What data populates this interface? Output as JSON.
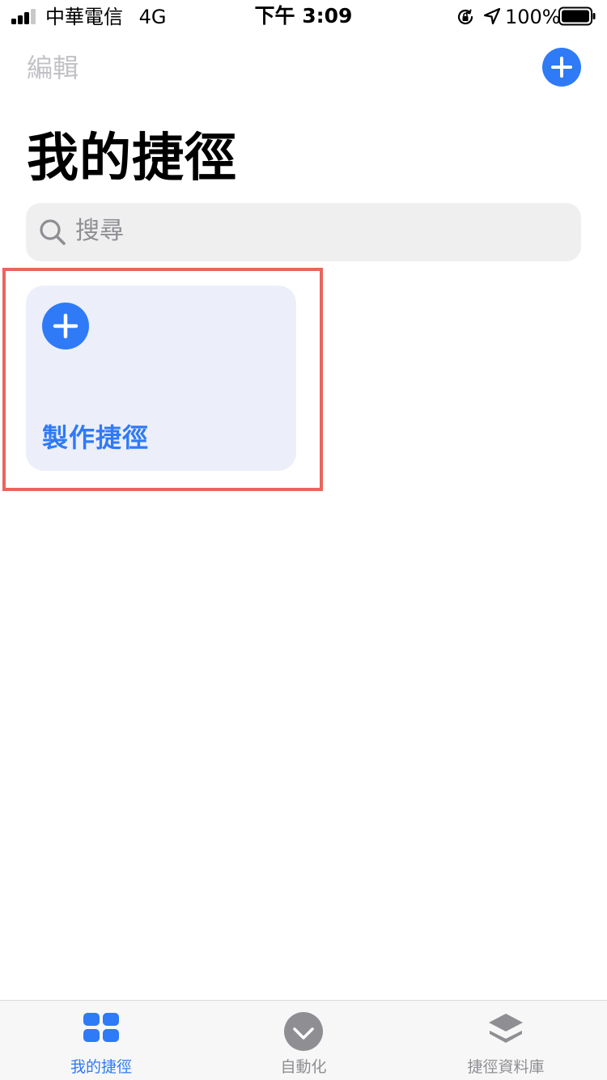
{
  "status_bar": {
    "carrier": "中華電信",
    "network": "4G",
    "time": "下午 3:09",
    "battery_percent": "100%"
  },
  "header": {
    "edit_label": "編輯",
    "add_icon": "plus-circle-icon",
    "title": "我的捷徑"
  },
  "search": {
    "placeholder": "搜尋"
  },
  "create_card": {
    "label": "製作捷徑",
    "icon": "plus-circle-icon"
  },
  "tab_bar": {
    "tabs": [
      {
        "label": "我的捷徑",
        "icon": "grid-icon",
        "active": true
      },
      {
        "label": "自動化",
        "icon": "checkmark-circle-icon",
        "active": false
      },
      {
        "label": "捷徑資料庫",
        "icon": "layers-icon",
        "active": false
      }
    ]
  },
  "colors": {
    "accent": "#2f7af7",
    "highlight_border": "#e8665c",
    "card_bg": "#eceffa",
    "inactive": "#8e8e93"
  }
}
